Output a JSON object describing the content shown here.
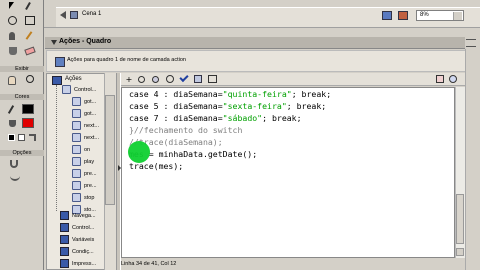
{
  "topbar": {
    "scene": "Cena 1",
    "zoom": "8%"
  },
  "left_panel": {
    "sections": {
      "view": "Exibir",
      "colors": "Cores",
      "options": "Opções"
    }
  },
  "actions_panel": {
    "title": "Ações - Quadro",
    "target": "Ações para quadro 1 de nome de camada action"
  },
  "library": {
    "header": "Ações",
    "items": [
      {
        "label": "Control..."
      },
      {
        "label": "got..."
      },
      {
        "label": "got..."
      },
      {
        "label": "next..."
      },
      {
        "label": "next..."
      },
      {
        "label": "on"
      },
      {
        "label": "play"
      },
      {
        "label": "pre..."
      },
      {
        "label": "pre..."
      },
      {
        "label": "stop"
      },
      {
        "label": "sto..."
      }
    ],
    "categories": [
      {
        "label": "Navega..."
      },
      {
        "label": "Control..."
      },
      {
        "label": "Variáveis"
      },
      {
        "label": "Condiç..."
      },
      {
        "label": "Impress..."
      }
    ]
  },
  "code_lines": [
    [
      {
        "t": "case 4 : diaSemana=",
        "c": "blk"
      },
      {
        "t": "\"quinta-feira\"",
        "c": "grn"
      },
      {
        "t": "; break;",
        "c": "blk"
      }
    ],
    [
      {
        "t": "case 5 : diaSemana=",
        "c": "blk"
      },
      {
        "t": "\"sexta-feira\"",
        "c": "grn"
      },
      {
        "t": "; break;",
        "c": "blk"
      }
    ],
    [
      {
        "t": "case 7 : diaSemana=",
        "c": "blk"
      },
      {
        "t": "\"sábado\"",
        "c": "grn"
      },
      {
        "t": "; break;",
        "c": "blk"
      }
    ],
    [
      {
        "t": "}//fechamento do switch",
        "c": "gry"
      }
    ],
    [
      {
        "t": "//trace(diaSemana);",
        "c": "gry"
      }
    ],
    [
      {
        "t": "mes = minhaData.getDate();",
        "c": "blk"
      }
    ],
    [
      {
        "t": "trace(mes);",
        "c": "blk"
      }
    ]
  ],
  "status": "Linha 34 de 41, Col 12"
}
